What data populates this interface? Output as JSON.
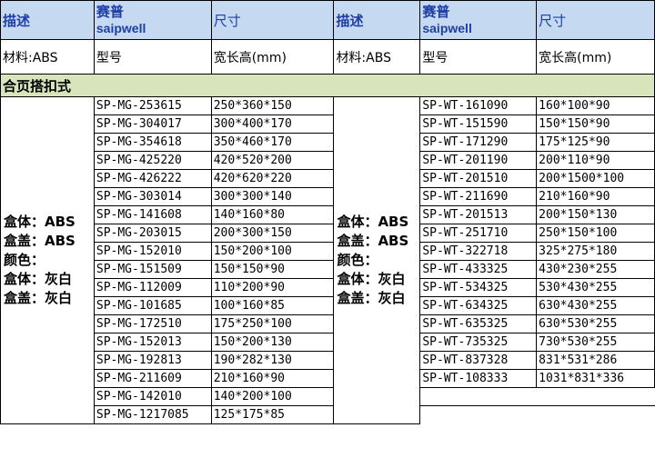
{
  "header": {
    "desc_label": "描述",
    "brand_cn": "赛普",
    "brand_en": "saipwell",
    "size_label": "尺寸"
  },
  "subheader": {
    "material": "材料:ABS",
    "model": "型号",
    "dims": "宽长高(mm)"
  },
  "section_title": "合页搭扣式",
  "description_lines": [
    "盒体：ABS",
    "盒盖：ABS",
    "颜色：",
    "盒体：灰白",
    "盒盖：灰白"
  ],
  "left_products": [
    {
      "model": "SP-MG-253615",
      "size": "250*360*150"
    },
    {
      "model": "SP-MG-304017",
      "size": "300*400*170"
    },
    {
      "model": "SP-MG-354618",
      "size": "350*460*170"
    },
    {
      "model": "SP-MG-425220",
      "size": "420*520*200"
    },
    {
      "model": "SP-MG-426222",
      "size": "420*620*220"
    },
    {
      "model": "SP-MG-303014",
      "size": "300*300*140"
    },
    {
      "model": "SP-MG-141608",
      "size": "140*160*80"
    },
    {
      "model": "SP-MG-203015",
      "size": "200*300*150"
    },
    {
      "model": "SP-MG-152010",
      "size": "150*200*100"
    },
    {
      "model": "SP-MG-151509",
      "size": "150*150*90"
    },
    {
      "model": "SP-MG-112009",
      "size": "110*200*90"
    },
    {
      "model": "SP-MG-101685",
      "size": "100*160*85"
    },
    {
      "model": "SP-MG-172510",
      "size": "175*250*100"
    },
    {
      "model": "SP-MG-152013",
      "size": "150*200*130"
    },
    {
      "model": "SP-MG-192813",
      "size": "190*282*130"
    },
    {
      "model": "SP-MG-211609",
      "size": "210*160*90"
    },
    {
      "model": "SP-MG-142010",
      "size": "140*200*100"
    },
    {
      "model": "SP-MG-1217085",
      "size": "125*175*85"
    }
  ],
  "right_products": [
    {
      "model": "SP-WT-161090",
      "size": "160*100*90"
    },
    {
      "model": "SP-WT-151590",
      "size": "150*150*90"
    },
    {
      "model": "SP-WT-171290",
      "size": "175*125*90"
    },
    {
      "model": "SP-WT-201190",
      "size": "200*110*90"
    },
    {
      "model": "SP-WT-201510",
      "size": "200*1500*100"
    },
    {
      "model": "SP-WT-211690",
      "size": "210*160*90"
    },
    {
      "model": "SP-WT-201513",
      "size": "200*150*130"
    },
    {
      "model": "SP-WT-251710",
      "size": "250*150*100"
    },
    {
      "model": "SP-WT-322718",
      "size": "325*275*180"
    },
    {
      "model": "SP-WT-433325",
      "size": "430*230*255"
    },
    {
      "model": "SP-WT-534325",
      "size": "530*430*255"
    },
    {
      "model": "SP-WT-634325",
      "size": "630*430*255"
    },
    {
      "model": "SP-WT-635325",
      "size": "630*530*255"
    },
    {
      "model": "SP-WT-735325",
      "size": "730*530*255"
    },
    {
      "model": "SP-WT-837328",
      "size": "831*531*286"
    },
    {
      "model": "SP-WT-108333",
      "size": "1031*831*336"
    }
  ]
}
